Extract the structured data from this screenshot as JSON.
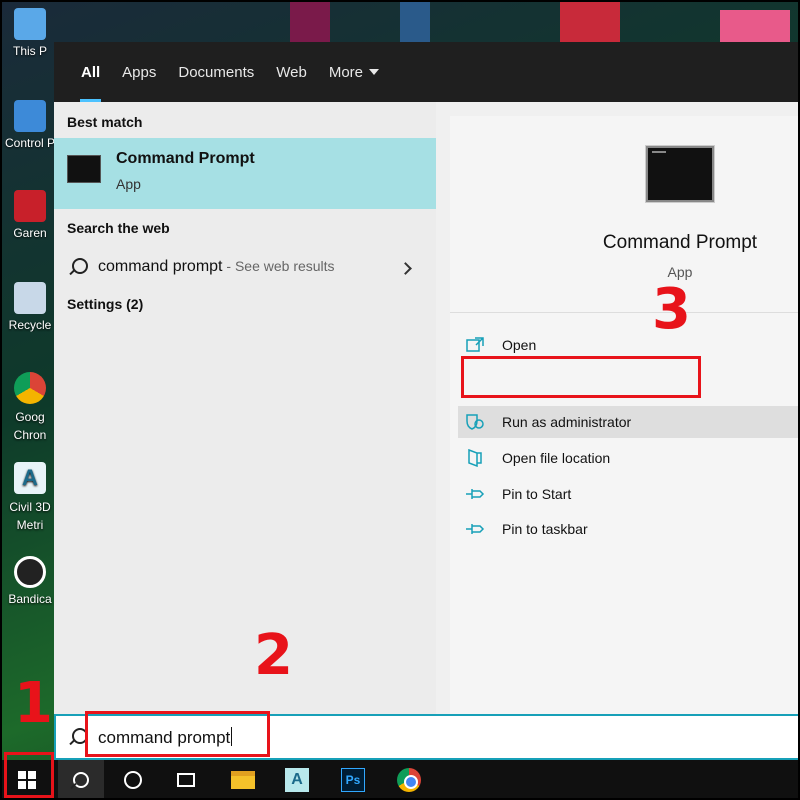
{
  "desktop": {
    "icons": [
      {
        "label": "This P",
        "icon": "computer-icon",
        "color": "#5aa8e8"
      },
      {
        "label": "Control P",
        "icon": "control-panel-icon",
        "color": "#3d8ad8"
      },
      {
        "label": "Garen",
        "icon": "garena-icon",
        "color": "#c8202a"
      },
      {
        "label": "Recycle",
        "icon": "recycle-bin-icon",
        "color": "#c8d8e8"
      },
      {
        "label": "Goog Chron",
        "icon": "chrome-icon",
        "color": "#f4b400"
      },
      {
        "label": "Civil 3D Metri",
        "icon": "civil-3d-icon",
        "color": "#1b6a8a"
      },
      {
        "label": "Bandica",
        "icon": "bandicam-icon",
        "color": "#222222"
      }
    ]
  },
  "start_menu": {
    "tabs": [
      "All",
      "Apps",
      "Documents",
      "Web",
      "More"
    ],
    "active_tab": "All",
    "best_match_title": "Best match",
    "best_match": {
      "name": "Command Prompt",
      "type": "App"
    },
    "search_web_title": "Search the web",
    "web_result": {
      "query": "command prompt",
      "suffix": " - See web results"
    },
    "settings_label": "Settings (2)",
    "detail": {
      "name": "Command Prompt",
      "type": "App",
      "actions": [
        {
          "label": "Open",
          "icon": "open-icon"
        },
        {
          "label": "Run as administrator",
          "icon": "shield-icon"
        },
        {
          "label": "Open file location",
          "icon": "file-location-icon"
        },
        {
          "label": "Pin to Start",
          "icon": "pin-icon"
        },
        {
          "label": "Pin to taskbar",
          "icon": "pin-icon"
        }
      ]
    }
  },
  "search_box": {
    "value": "command prompt"
  },
  "taskbar": {
    "items": [
      "start-button",
      "search-button",
      "cortana-button",
      "task-view-button",
      "file-explorer",
      "autocad",
      "photoshop",
      "chrome"
    ],
    "ps_label": "Ps",
    "autocad_label": "A"
  },
  "annotations": {
    "step1": "1",
    "step2": "2",
    "step3": "3",
    "color": "#e8131a"
  }
}
